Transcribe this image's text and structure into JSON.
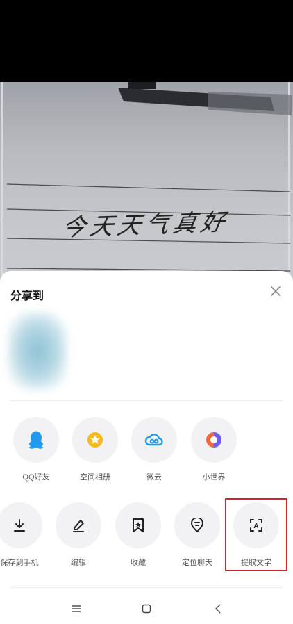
{
  "photo": {
    "handwriting": "今天天气真好",
    "description_icon": "notebook-photo"
  },
  "sheet": {
    "title": "分享到",
    "close_icon": "close-icon"
  },
  "share_targets": [
    {
      "label": "QQ好友",
      "icon": "qq-icon",
      "color": "#1e9bf0"
    },
    {
      "label": "空间相册",
      "icon": "qzone-album-icon",
      "color": "#f5b81f"
    },
    {
      "label": "微云",
      "icon": "weiyun-icon",
      "color": "#1e9bf0"
    },
    {
      "label": "小世界",
      "icon": "small-world-icon",
      "color": "#f0673a"
    }
  ],
  "actions": [
    {
      "label": "保存到手机",
      "icon": "download-icon"
    },
    {
      "label": "编辑",
      "icon": "edit-icon"
    },
    {
      "label": "收藏",
      "icon": "favorite-icon"
    },
    {
      "label": "定位聊天",
      "icon": "locate-chat-icon"
    },
    {
      "label": "提取文字",
      "icon": "extract-text-icon"
    }
  ],
  "navbar": {
    "menu_icon": "menu-icon",
    "home_icon": "home-icon",
    "back_icon": "back-icon"
  },
  "colors": {
    "highlight": "#d0252d",
    "circle_bg": "#f2f2f4"
  }
}
